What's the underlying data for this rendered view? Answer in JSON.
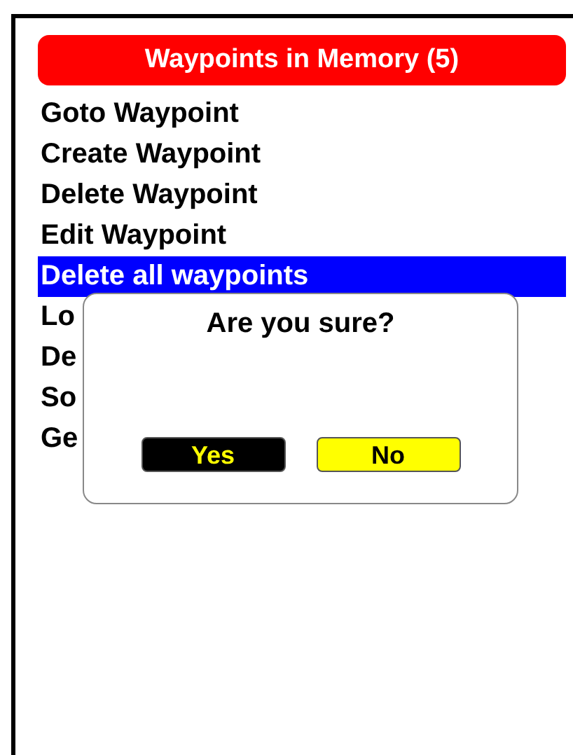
{
  "title": "Waypoints in Memory (5)",
  "menu_items": [
    {
      "label": "Goto Waypoint",
      "selected": false
    },
    {
      "label": "Create Waypoint",
      "selected": false
    },
    {
      "label": "Delete Waypoint",
      "selected": false
    },
    {
      "label": "Edit Waypoint",
      "selected": false
    },
    {
      "label": "Delete all waypoints",
      "selected": true
    },
    {
      "label": "Lo",
      "selected": false
    },
    {
      "label": "De",
      "selected": false
    },
    {
      "label": "So",
      "selected": false
    },
    {
      "label": "Ge",
      "selected": false
    }
  ],
  "dialog": {
    "message": "Are you sure?",
    "buttons": [
      {
        "label": "Yes",
        "selected": true
      },
      {
        "label": "No",
        "selected": false
      }
    ]
  }
}
